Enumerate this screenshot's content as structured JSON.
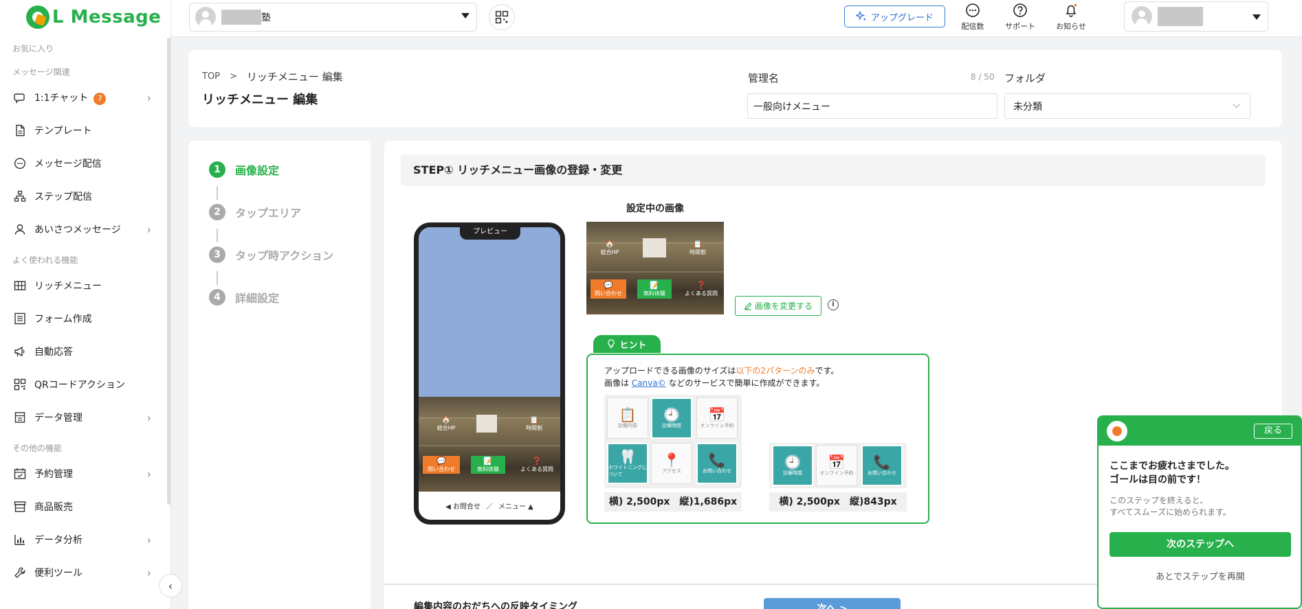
{
  "brand": {
    "name": "L Message",
    "color": "#27b04b"
  },
  "header": {
    "account_name_suffix": "塾",
    "upgrade_label": "アップグレード",
    "icons": [
      {
        "name": "delivery-count",
        "label": "配信数",
        "icon": "chat-bubble-icon"
      },
      {
        "name": "support",
        "label": "サポート",
        "icon": "question-icon"
      },
      {
        "name": "notifications",
        "label": "お知らせ",
        "icon": "bell-icon"
      }
    ]
  },
  "sidebar": {
    "sections": {
      "favorites": "お気に入り",
      "messages": "メッセージ関連",
      "common": "よく使われる機能",
      "other": "その他の機能"
    },
    "items": {
      "chat": {
        "label": "1:1チャット",
        "badge": "7"
      },
      "template": {
        "label": "テンプレート"
      },
      "broadcast": {
        "label": "メッセージ配信"
      },
      "step": {
        "label": "ステップ配信"
      },
      "greeting": {
        "label": "あいさつメッセージ"
      },
      "richmenu": {
        "label": "リッチメニュー"
      },
      "form": {
        "label": "フォーム作成"
      },
      "autoreply": {
        "label": "自動応答"
      },
      "qr": {
        "label": "QRコードアクション"
      },
      "data": {
        "label": "データ管理"
      },
      "reservation": {
        "label": "予約管理"
      },
      "sales": {
        "label": "商品販売"
      },
      "analytics": {
        "label": "データ分析"
      },
      "tools": {
        "label": "便利ツール"
      }
    }
  },
  "page": {
    "breadcrumb_top": "TOP",
    "breadcrumb_sep": ">",
    "breadcrumb_current": "リッチメニュー 編集",
    "title": "リッチメニュー 編集",
    "name_label": "管理名",
    "name_counter": "8 / 50",
    "name_value": "一般向けメニュー",
    "folder_label": "フォルダ",
    "folder_value": "未分類"
  },
  "steps": [
    {
      "num": "1",
      "label": "画像設定",
      "active": true
    },
    {
      "num": "2",
      "label": "タップエリア",
      "active": false
    },
    {
      "num": "3",
      "label": "タップ時アクション",
      "active": false
    },
    {
      "num": "4",
      "label": "詳細設定",
      "active": false
    }
  ],
  "main": {
    "step_heading": "STEP① リッチメニュー画像の登録・変更",
    "phone_notch": "プレビュー",
    "phone_footer_left": "◀ お問合せ",
    "phone_footer_sep": "／",
    "phone_footer_right": "メニュー ▲",
    "current_image_label": "設定中の画像",
    "change_image_label": "画像を変更する",
    "menu_cells": {
      "hp": "総合HP",
      "schedule": "時間割",
      "contact": "問い合わせ",
      "trial": "無料体験",
      "faq": "よくある質問"
    },
    "hint_tab": "ヒント",
    "hint_line1_pre": "アップロードできる画像のサイズは",
    "hint_line1_em": "以下の2パターンのみ",
    "hint_line1_post": "です。",
    "hint_line2_pre": "画像は ",
    "hint_line2_link": "Canva©",
    "hint_line2_post": " などのサービスで簡単に作成ができます。",
    "pattern1_label": "横) 2,500px　縦)1,686px",
    "pattern2_label": "横) 2,500px　縦)843px",
    "tiles": {
      "t1": "診療内容",
      "t2": "診療時間",
      "t3": "オンライン予約",
      "t4": "ホワイトニングについて",
      "t5": "アクセス",
      "t6": "お問い合わせ"
    },
    "bottom_label": "編集内容のおだちへの反映タイミング",
    "next_label": "次へ >"
  },
  "tutorial": {
    "back_label": "戻る",
    "title_line1": "ここまでお疲れさまでした。",
    "title_line2": "ゴールは目の前です！",
    "desc_line1": "このステップを終えると、",
    "desc_line2": "すべてスムーズに始められます。",
    "next_label": "次のステップへ",
    "later_label": "あとでステップを再開"
  }
}
